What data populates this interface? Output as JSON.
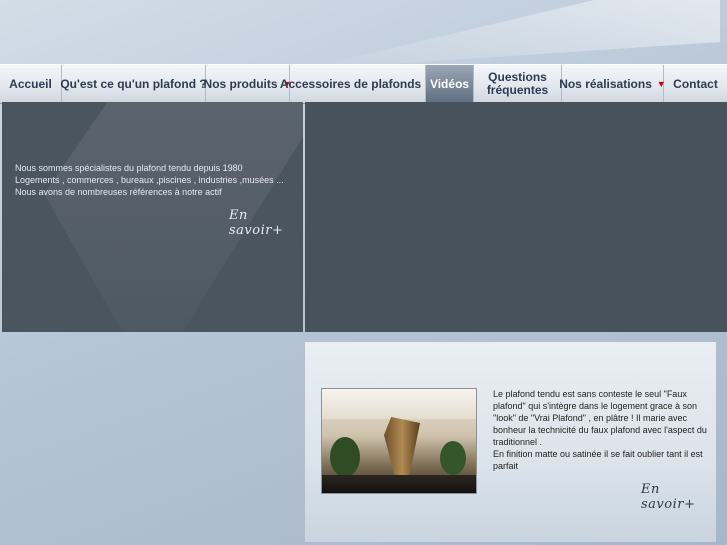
{
  "nav": {
    "items": [
      {
        "label": "Accueil"
      },
      {
        "label": "Qu'est ce qu'un plafond ?"
      },
      {
        "label": "Nos produits"
      },
      {
        "label": "Accessoires de plafonds"
      },
      {
        "label": "Vidéos"
      },
      {
        "label_line1": "Questions",
        "label_line2": "fréquentes"
      },
      {
        "label": "Nos réalisations"
      },
      {
        "label": "Contact"
      }
    ],
    "dropdown_arrow": "▼",
    "active_item": "Vidéos"
  },
  "intro": {
    "line1": "Nous sommes spécialistes du plafond tendu depuis 1980",
    "line2": "Logements , commerces , bureaux ,piscines , industries ,musées ...",
    "line3": "Nous avons  de nombreuses références à notre actif"
  },
  "more_link": "En savoir+",
  "product": {
    "description_line1": "Le plafond tendu est sans conteste  le seul \"Faux plafond\" qui s'intègre  dans le logement grace à son \"look\" de  \"Vrai Plafond\" , en plâtre ! Il marie avec bonheur la technicité du faux plafond avec l'aspect du traditionnel .",
    "description_line2": "En finition matte ou satinée il se fait oublier tant il est parfait"
  },
  "colors": {
    "dark_panel": "#4b5560",
    "nav_text": "#2d3c52",
    "arrow": "#d00000"
  }
}
